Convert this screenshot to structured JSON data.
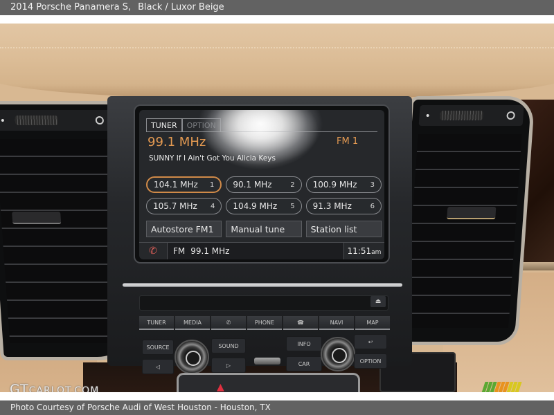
{
  "header": {
    "vehicle": "2014 Porsche Panamera S,",
    "color": "Black / Luxor Beige"
  },
  "footer": {
    "credit": "Photo Courtesy of Porsche Audi of West Houston - Houston, TX"
  },
  "watermark": {
    "left_main": "GT",
    "left_rest": "CARLOT.COM",
    "logo_colors": [
      "#5aa832",
      "#e8921e",
      "#d8c820"
    ]
  },
  "screen": {
    "tabs": [
      {
        "label": "TUNER",
        "active": true
      },
      {
        "label": "OPTION",
        "active": false
      }
    ],
    "current_frequency": "99.1 MHz",
    "band": "FM 1",
    "rds_text": "SUNNY If I Ain't Got You Alicia Keys",
    "presets": [
      {
        "freq": "104.1 MHz",
        "num": "1",
        "active": true
      },
      {
        "freq": "90.1 MHz",
        "num": "2",
        "active": false
      },
      {
        "freq": "100.9 MHz",
        "num": "3",
        "active": false
      },
      {
        "freq": "105.7 MHz",
        "num": "4",
        "active": false
      },
      {
        "freq": "104.9 MHz",
        "num": "5",
        "active": false
      },
      {
        "freq": "91.3 MHz",
        "num": "6",
        "active": false
      }
    ],
    "actions": [
      "Autostore FM1",
      "Manual tune",
      "Station list"
    ],
    "status": {
      "phone_icon": "phone-disconnected-icon",
      "source": "FM",
      "frequency": "99.1 MHz",
      "time": "11:51",
      "ampm": "am"
    },
    "accent_color": "#e49a52"
  },
  "hardware_buttons": {
    "top_row": [
      "TUNER",
      "MEDIA",
      "✆",
      "PHONE",
      "☎",
      "NAVI",
      "MAP"
    ],
    "source": "SOURCE",
    "sound": "SOUND",
    "info": "INFO",
    "car": "CAR",
    "option": "OPTION",
    "back": "↩",
    "prev": "◁",
    "next": "▷",
    "eject": "⏏"
  }
}
